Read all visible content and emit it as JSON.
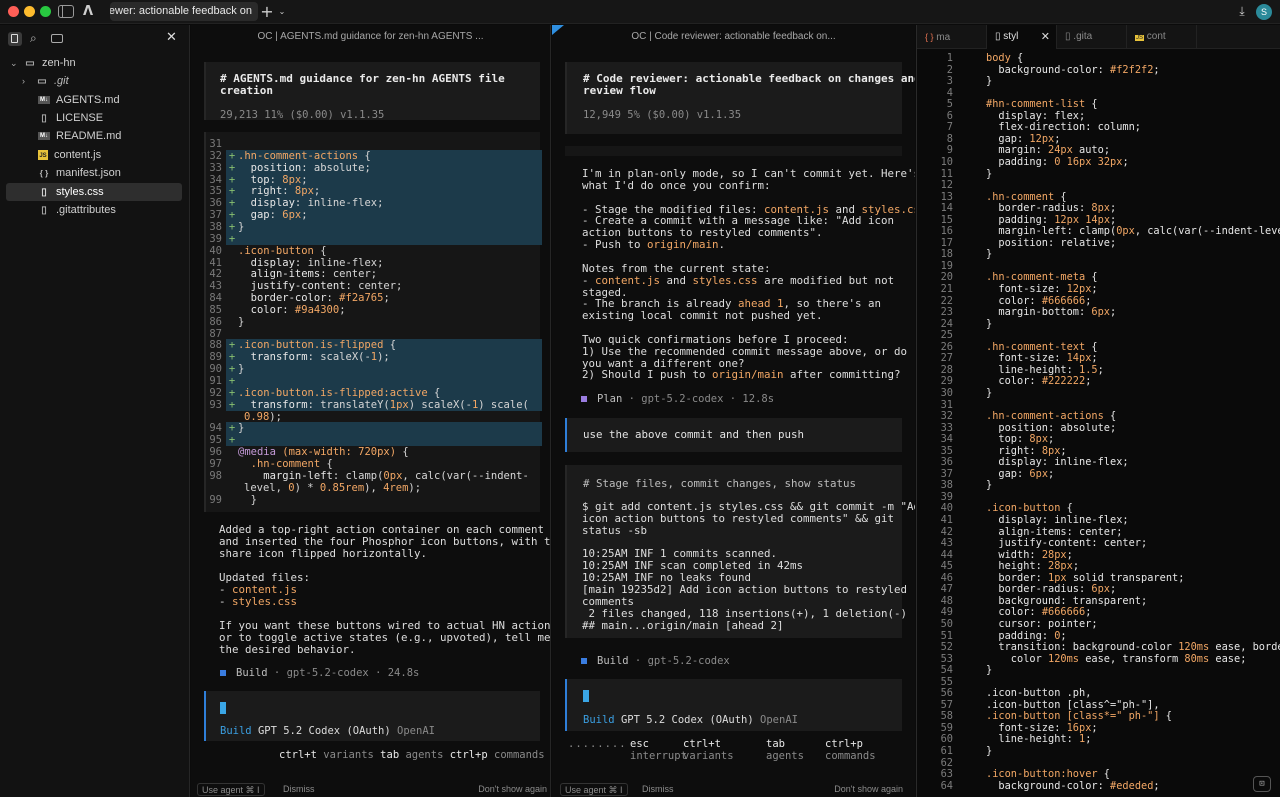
{
  "titlebar": {
    "tab_title": "viewer: actionable feedback on...",
    "colors": {
      "close": "#ff5f57",
      "minimize": "#febc2e",
      "maximize": "#28c840"
    },
    "avatar_letter": "S"
  },
  "sidebar": {
    "root": "zen-hn",
    "items": [
      {
        "name": ".git",
        "type": "folder",
        "icon": "folder-icon"
      },
      {
        "name": "AGENTS.md",
        "type": "md",
        "icon": "markdown-file-icon"
      },
      {
        "name": "LICENSE",
        "type": "file",
        "icon": "file-icon"
      },
      {
        "name": "README.md",
        "type": "md",
        "icon": "markdown-file-icon"
      },
      {
        "name": "content.js",
        "type": "js",
        "icon": "js-file-icon"
      },
      {
        "name": "manifest.json",
        "type": "json",
        "icon": "json-file-icon"
      },
      {
        "name": "styles.css",
        "type": "css",
        "icon": "file-icon",
        "selected": true
      },
      {
        "name": ".gitattributes",
        "type": "file",
        "icon": "file-icon"
      }
    ]
  },
  "pane1": {
    "header": "OC | AGENTS.md guidance for zen-hn AGENTS ...",
    "card_title": "# AGENTS.md guidance for zen-hn AGENTS file creation",
    "card_meta": "29,213  11% ($0.00) v1.1.35",
    "diff": [
      {
        "n": "31",
        "m": "",
        "code": ""
      },
      {
        "n": "32",
        "m": "+",
        "code": ".hn-comment-actions {"
      },
      {
        "n": "33",
        "m": "+",
        "code": "  position: absolute;"
      },
      {
        "n": "34",
        "m": "+",
        "code": "  top: 8px;"
      },
      {
        "n": "35",
        "m": "+",
        "code": "  right: 8px;"
      },
      {
        "n": "36",
        "m": "+",
        "code": "  display: inline-flex;"
      },
      {
        "n": "37",
        "m": "+",
        "code": "  gap: 6px;"
      },
      {
        "n": "38",
        "m": "+",
        "code": "}"
      },
      {
        "n": "39",
        "m": "+",
        "code": ""
      },
      {
        "n": "40",
        "m": "",
        "code": ".icon-button {"
      },
      {
        "n": "41",
        "m": "",
        "code": "  display: inline-flex;"
      },
      {
        "n": "42",
        "m": "",
        "code": "  align-items: center;"
      },
      {
        "n": "43",
        "m": "",
        "code": "  justify-content: center;"
      },
      {
        "n": "84",
        "m": "",
        "code": "  border-color: #f2a765;"
      },
      {
        "n": "85",
        "m": "",
        "code": "  color: #9a4300;"
      },
      {
        "n": "86",
        "m": "",
        "code": "}"
      },
      {
        "n": "87",
        "m": "",
        "code": ""
      },
      {
        "n": "88",
        "m": "+",
        "code": ".icon-button.is-flipped {"
      },
      {
        "n": "89",
        "m": "+",
        "code": "  transform: scaleX(-1);"
      },
      {
        "n": "90",
        "m": "+",
        "code": "}"
      },
      {
        "n": "91",
        "m": "+",
        "code": ""
      },
      {
        "n": "92",
        "m": "+",
        "code": ".icon-button.is-flipped:active {"
      },
      {
        "n": "93",
        "m": "+",
        "code": "  transform: translateY(1px) scaleX(-1) scale("
      },
      {
        "n": "",
        "m": "",
        "code": "0.98);"
      },
      {
        "n": "94",
        "m": "+",
        "code": "}"
      },
      {
        "n": "95",
        "m": "+",
        "code": ""
      },
      {
        "n": "96",
        "m": "",
        "code": "@media (max-width: 720px) {"
      },
      {
        "n": "97",
        "m": "",
        "code": "  .hn-comment {"
      },
      {
        "n": "98",
        "m": "",
        "code": "    margin-left: clamp(0px, calc(var(--indent-"
      },
      {
        "n": "",
        "m": "",
        "code": "level, 0) * 0.85rem), 4rem);"
      },
      {
        "n": "99",
        "m": "",
        "code": "  }"
      }
    ],
    "message": [
      "Added a top-right action container on each comment",
      "and inserted the four Phosphor icon buttons, with the",
      "share icon flipped horizontally.",
      "",
      "Updated files:",
      "- content.js",
      "- styles.css",
      "",
      "If you want these buttons wired to actual HN actions",
      "or to toggle active states (e.g., upvoted), tell me",
      "the desired behavior."
    ],
    "status": {
      "mode": "Build",
      "model": "gpt-5.2-codex",
      "time": "24.8s"
    },
    "input": {
      "mode": "Build",
      "model": "GPT 5.2 Codex (OAuth)",
      "provider": "OpenAI"
    },
    "shortcuts": [
      {
        "key": "ctrl+t",
        "label": "variants"
      },
      {
        "key": "tab",
        "label": "agents"
      },
      {
        "key": "ctrl+p",
        "label": "commands"
      }
    ],
    "footer": {
      "use_agent": "Use agent",
      "shortcut": "⌘ I",
      "dismiss": "Dismiss",
      "dont_show": "Don't show again"
    }
  },
  "pane2": {
    "header": "OC | Code reviewer: actionable feedback on...",
    "card_title": "# Code reviewer: actionable feedback on changes and\nreview flow",
    "card_meta": "12,949  5% ($0.00) v1.1.35",
    "message": [
      "I'm in plan-only mode, so I can't commit yet. Here's",
      "what I'd do once you confirm:",
      "",
      "- Stage the modified files: content.js and styles.css.",
      "- Create a commit with a message like: \"Add icon",
      "action buttons to restyled comments\".",
      "- Push to origin/main.",
      "",
      "Notes from the current state:",
      "- content.js and styles.css are modified but not",
      "staged.",
      "- The branch is already ahead 1, so there's an",
      "existing local commit not pushed yet.",
      "",
      "Two quick confirmations before I proceed:",
      "1) Use the recommended commit message above, or do",
      "you want a different one?",
      "2) Should I push to origin/main after committing?"
    ],
    "plan_status": {
      "mode": "Plan",
      "model": "gpt-5.2-codex",
      "time": "12.8s"
    },
    "user_message": "use the above commit and then push",
    "tool_title": "# Stage files, commit changes, show status",
    "tool_output": [
      "$ git add content.js styles.css && git commit -m \"Add",
      "icon action buttons to restyled comments\" && git",
      "status -sb",
      "",
      "10:25AM INF 1 commits scanned.",
      "10:25AM INF scan completed in 42ms",
      "10:25AM INF no leaks found",
      "[main 19235d2] Add icon action buttons to restyled",
      "comments",
      " 2 files changed, 118 insertions(+), 1 deletion(-)",
      "## main...origin/main [ahead 2]"
    ],
    "build_status": {
      "mode": "Build",
      "model": "gpt-5.2-codex"
    },
    "input": {
      "mode": "Build",
      "model": "GPT 5.2 Codex (OAuth)",
      "provider": "OpenAI"
    },
    "shortcuts": [
      {
        "key": "esc",
        "label": "interrupt"
      },
      {
        "key": "ctrl+t",
        "label": "variants"
      },
      {
        "key": "tab",
        "label": "agents"
      },
      {
        "key": "ctrl+p",
        "label": "commands"
      }
    ],
    "progress_dots": "........",
    "footer": {
      "use_agent": "Use agent",
      "shortcut": "⌘ I",
      "dismiss": "Dismiss",
      "dont_show": "Don't show again"
    }
  },
  "editor": {
    "tabs": [
      {
        "label": "ma",
        "icon": "json-file-icon",
        "active": false
      },
      {
        "label": "styl",
        "icon": "file-icon",
        "active": true
      },
      {
        "label": ".gita",
        "icon": "file-icon",
        "active": false
      },
      {
        "label": "cont",
        "icon": "js-file-icon",
        "active": false
      }
    ],
    "lines": [
      "body {",
      "  background-color: #f2f2f2;",
      "}",
      "",
      "#hn-comment-list {",
      "  display: flex;",
      "  flex-direction: column;",
      "  gap: 12px;",
      "  margin: 24px auto;",
      "  padding: 0 16px 32px;",
      "}",
      "",
      ".hn-comment {",
      "  border-radius: 8px;",
      "  padding: 12px 14px;",
      "  margin-left: clamp(0px, calc(var(--indent-level",
      "  position: relative;",
      "}",
      "",
      ".hn-comment-meta {",
      "  font-size: 12px;",
      "  color: #666666;",
      "  margin-bottom: 6px;",
      "}",
      "",
      ".hn-comment-text {",
      "  font-size: 14px;",
      "  line-height: 1.5;",
      "  color: #222222;",
      "}",
      "",
      ".hn-comment-actions {",
      "  position: absolute;",
      "  top: 8px;",
      "  right: 8px;",
      "  display: inline-flex;",
      "  gap: 6px;",
      "}",
      "",
      ".icon-button {",
      "  display: inline-flex;",
      "  align-items: center;",
      "  justify-content: center;",
      "  width: 28px;",
      "  height: 28px;",
      "  border: 1px solid transparent;",
      "  border-radius: 6px;",
      "  background: transparent;",
      "  color: #666666;",
      "  cursor: pointer;",
      "  padding: 0;",
      "  transition: background-color 120ms ease, borde",
      "    color 120ms ease, transform 80ms ease;",
      "}",
      "",
      ".icon-button .ph,",
      ".icon-button [class^=\"ph-\"],",
      ".icon-button [class*=\" ph-\"] {",
      "  font-size: 16px;",
      "  line-height: 1;",
      "}",
      "",
      ".icon-button:hover {",
      "  background-color: #ededed;"
    ]
  }
}
